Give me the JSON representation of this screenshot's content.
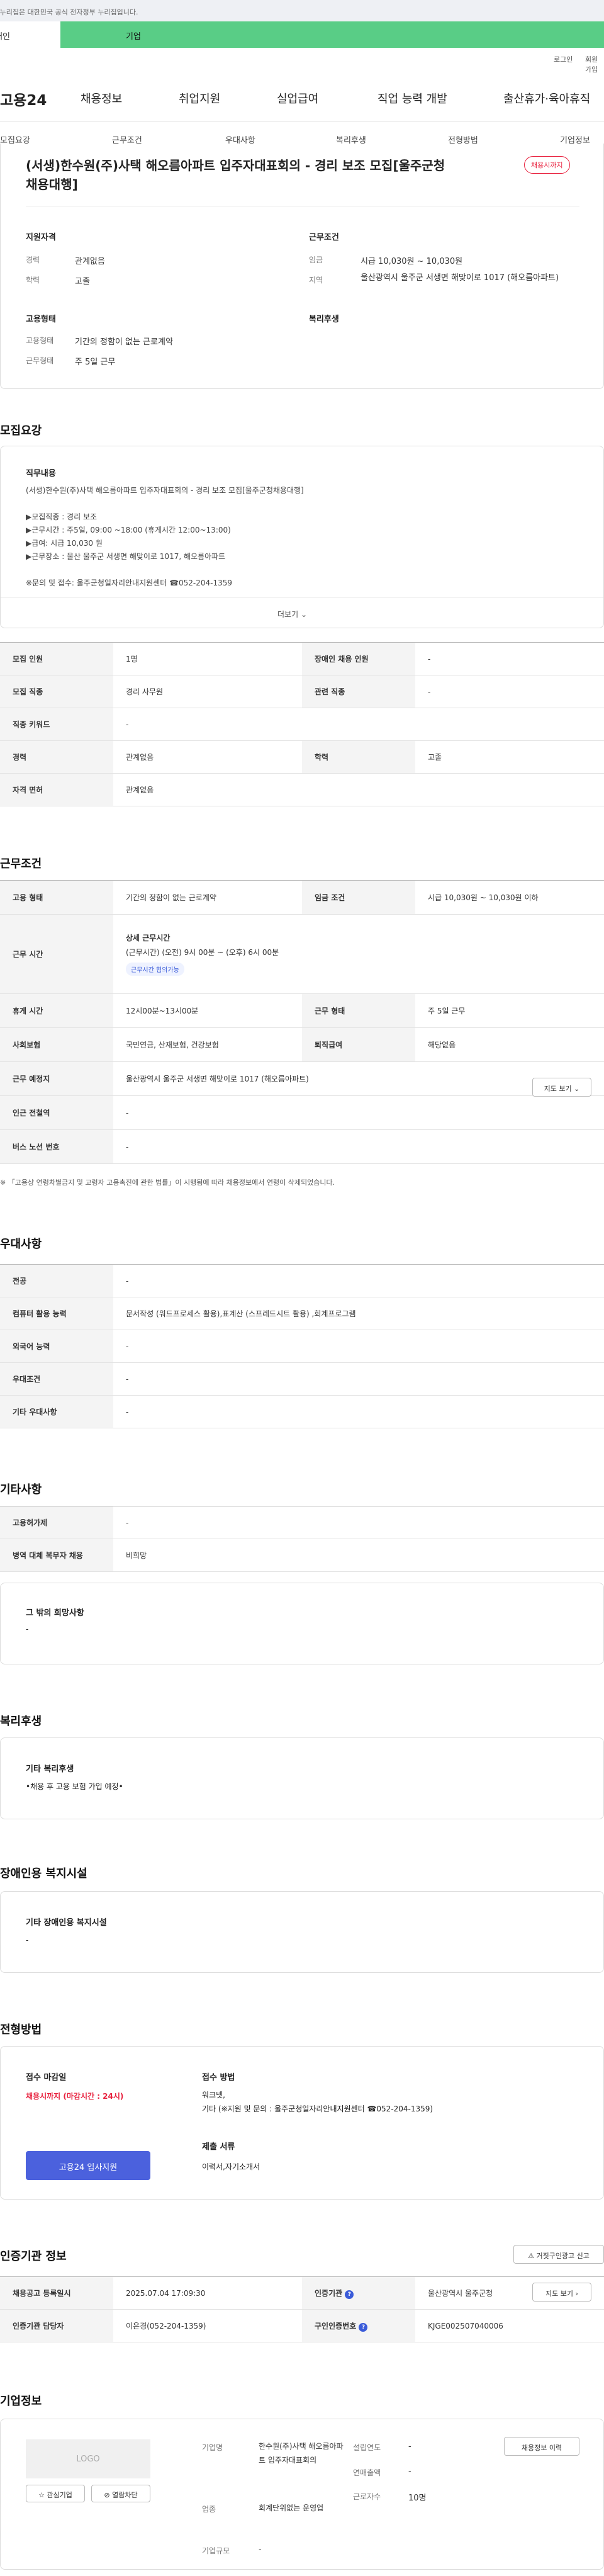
{
  "banner": {
    "text": "이 누리집은 대한민국 공식 전자정부 누리집입니다."
  },
  "gov_tabs": [
    "개인",
    "기업"
  ],
  "util": {
    "login": "로그인",
    "join": "회원가입"
  },
  "gnb": {
    "logo": "고용24",
    "items": [
      "채용정보",
      "취업지원",
      "실업급여",
      "직업 능력 개발",
      "출산휴가·육아휴직"
    ]
  },
  "subnav": [
    "모집요강",
    "근무조건",
    "우대사항",
    "복리후생",
    "전형방법",
    "기업정보"
  ],
  "summary": {
    "title": "(서생)한수원(주)사택 해오름아파트 입주자대표회의 - 경리 보조 모집[울주군청채용대행]",
    "badge": "채용시까지",
    "qual_title": "지원자격",
    "career_lbl": "경력",
    "career": "관계없음",
    "edu_lbl": "학력",
    "edu": "고졸",
    "cond_title": "근무조건",
    "wage_lbl": "임금",
    "wage": "시급 10,030원 ~ 10,030원",
    "area_lbl": "지역",
    "area": "울산광역시 울주군 서생면 해맞이로 1017 (해오름아파트)",
    "emp_title": "고용형태",
    "emptype_lbl": "고용형태",
    "emptype": "기간의 정함이 없는 근로계약",
    "worktype_lbl": "근무형태",
    "worktype": "주 5일 근무",
    "welfare_title": "복리후생"
  },
  "recruit": {
    "heading": "모집요강",
    "duty_title": "직무내용",
    "duty_text": "(서생)한수원(주)사택 해오름아파트 입주자대표회의 - 경리 보조 모집[울주군청채용대행]\n\n  ▶모집직종 : 경리 보조\n  ▶근무시간 : 주5일, 09:00 ~18:00 (휴게시간 12:00~13:00)\n  ▶급여: 시급 10,030 원\n  ▶근무장소 : 울산 울주군 서생면 해맞이로 1017, 해오름아파트\n\n※문의 및 접수: 울주군청일자리안내지원센터 ☎052-204-1359",
    "more": "더보기",
    "rows": [
      [
        "모집 인원",
        "1명",
        "장애인 채용 인원",
        "-"
      ],
      [
        "모집 직종",
        "경리 사무원",
        "관련 직종",
        "-"
      ],
      [
        "직종 키워드",
        "-"
      ],
      [
        "경력",
        "관계없음",
        "학력",
        "고졸"
      ],
      [
        "자격 면허",
        "관계없음"
      ]
    ]
  },
  "conditions": {
    "heading": "근무조건",
    "emptype_th": "고용 형태",
    "emptype": "기간의 정함이 없는 근로계약",
    "wage_th": "임금 조건",
    "wage": "시급 10,030원 ~ 10,030원 이하",
    "time_th": "근무 시간",
    "time_title": "상세 근무시간",
    "time_detail": "(근무시간) (오전) 9시 00분 ~ (오후) 6시 00분",
    "time_tag": "근무시간 협의가능",
    "rest_th": "휴게 시간",
    "rest": "12시00분~13시00분",
    "worktype_th": "근무 형태",
    "worktype": "주 5일 근무",
    "ins_th": "사회보험",
    "ins": "국민연금, 산재보험, 건강보험",
    "sev_th": "퇴직급여",
    "sev": "해당없음",
    "place_th": "근무 예정지",
    "place": "울산광역시 울주군 서생면 해맞이로 1017 (해오름아파트)",
    "map": "지도 보기",
    "sub_th": "인근 전철역",
    "sub": "-",
    "bus_th": "버스 노선 번호",
    "bus": "-",
    "note": "「고용상 연령차별금지 및 고령자 고용촉진에 관한 법률」이 시행됨에 따라 채용정보에서 연령이 삭제되었습니다."
  },
  "pref": {
    "heading": "우대사항",
    "rows": [
      [
        "전공",
        "-"
      ],
      [
        "컴퓨터 활용 능력",
        "문서작성 (워드프로세스 활용),표계산 (스프레드시트 활용) ,회계프로그램"
      ],
      [
        "외국어 능력",
        "-"
      ],
      [
        "우대조건",
        "-"
      ],
      [
        "기타 우대사항",
        "-"
      ]
    ]
  },
  "etc": {
    "heading": "기타사항",
    "rows": [
      [
        "고용허가제",
        "-"
      ],
      [
        "병역 대체 복무자 채용",
        "비희망"
      ]
    ],
    "hope_title": "그 밖의 희망사항",
    "hope": "-"
  },
  "welfare": {
    "heading": "복리후생",
    "title": "기타 복리후생",
    "text": "•채용 후 고용 보험 가입 예정•"
  },
  "disab": {
    "heading": "장애인용 복지시설",
    "title": "기타 장애인용 복지시설",
    "text": "-"
  },
  "screening": {
    "heading": "전형방법",
    "deadline_title": "접수 마감일",
    "deadline": "채용시까지 (마감시간 : 24시)",
    "apply_btn": "고용24 입사지원",
    "method_title": "접수 방법",
    "method": "워크넷,\n기타 (※지원 및 문의 : 울주군청일자리안내지원센터 ☎052-204-1359)",
    "docs_title": "제출 서류",
    "docs": "이력서,자기소개서"
  },
  "agency": {
    "heading": "인증기관 정보",
    "report_btn": "거짓구인광고 신고",
    "reg_th": "채용공고 등록일시",
    "reg": "2025.07.04 17:09:30",
    "org_th": "인증기관",
    "org": "울산광역시 울주군청",
    "map": "지도 보기",
    "mgr_th": "인증기관 담당자",
    "mgr": "이은경(052-204-1359)",
    "num_th": "구인인증번호",
    "num": "KJGE002507040006"
  },
  "company": {
    "heading": "기업정보",
    "logo": "LOGO",
    "fav_btn": "관심기업",
    "block_btn": "열람차단",
    "name_lbl": "기업명",
    "name": "한수원(주)사택 해오름아파트 입주자대표회의",
    "ind_lbl": "업종",
    "ind": "회계단위없는 운영업",
    "size_lbl": "기업규모",
    "size": "-",
    "year_lbl": "설립연도",
    "year": "-",
    "sales_lbl": "연매출액",
    "sales": "-",
    "staff_lbl": "근로자수",
    "staff": "10명",
    "history_btn": "채용정보 이력"
  }
}
